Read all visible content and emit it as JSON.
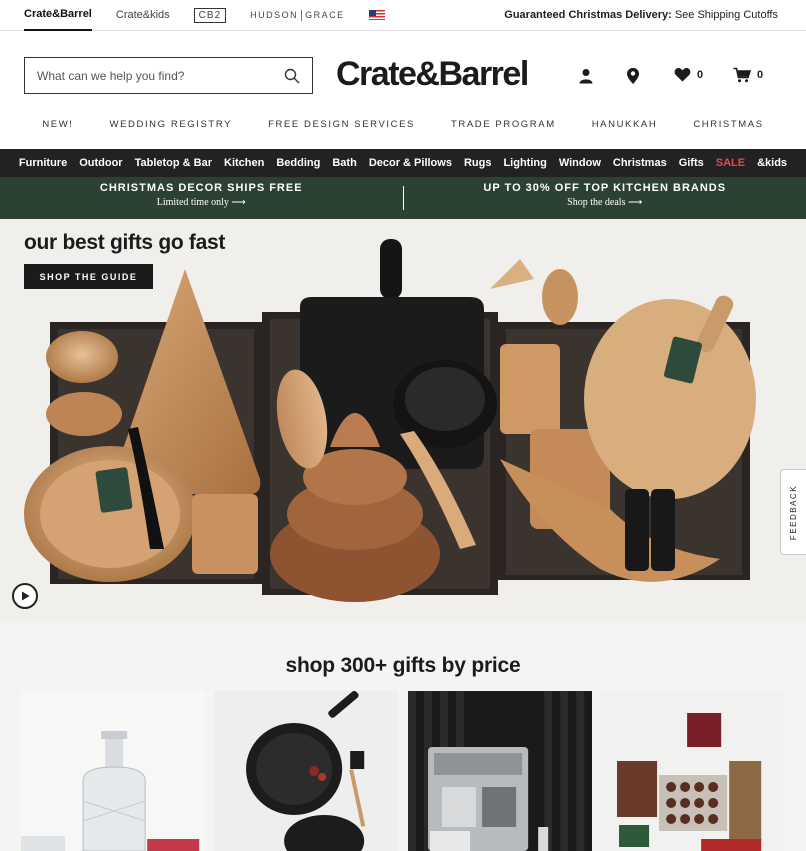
{
  "brandbar": {
    "brands": [
      "Crate&Barrel",
      "Crate&kids",
      "CB2",
      "HUDSON",
      "GRACE"
    ],
    "delivery_bold": "Guaranteed Christmas Delivery:",
    "delivery_link": "See Shipping Cutoffs"
  },
  "header": {
    "search_placeholder": "What can we help you find?",
    "logo": "Crate&Barrel",
    "wishlist_count": "0",
    "cart_count": "0"
  },
  "promonav": [
    "NEW!",
    "WEDDING REGISTRY",
    "FREE DESIGN SERVICES",
    "TRADE PROGRAM",
    "HANUKKAH",
    "CHRISTMAS"
  ],
  "categories": [
    "Furniture",
    "Outdoor",
    "Tabletop & Bar",
    "Kitchen",
    "Bedding",
    "Bath",
    "Decor & Pillows",
    "Rugs",
    "Lighting",
    "Window",
    "Christmas",
    "Gifts",
    "SALE",
    "&kids"
  ],
  "promos": [
    {
      "title": "CHRISTMAS DECOR SHIPS FREE",
      "sub": "Limited time only ⟶"
    },
    {
      "title": "UP TO 30% OFF TOP KITCHEN BRANDS",
      "sub": "Shop the deals ⟶"
    }
  ],
  "hero": {
    "headline": "our best gifts go fast",
    "cta": "SHOP THE GUIDE",
    "feedback": "FEEDBACK"
  },
  "price_section": {
    "title": "shop 300+ gifts by price"
  },
  "colors": {
    "dark": "#222222",
    "green": "#2b4233",
    "sale": "#e8484b"
  }
}
